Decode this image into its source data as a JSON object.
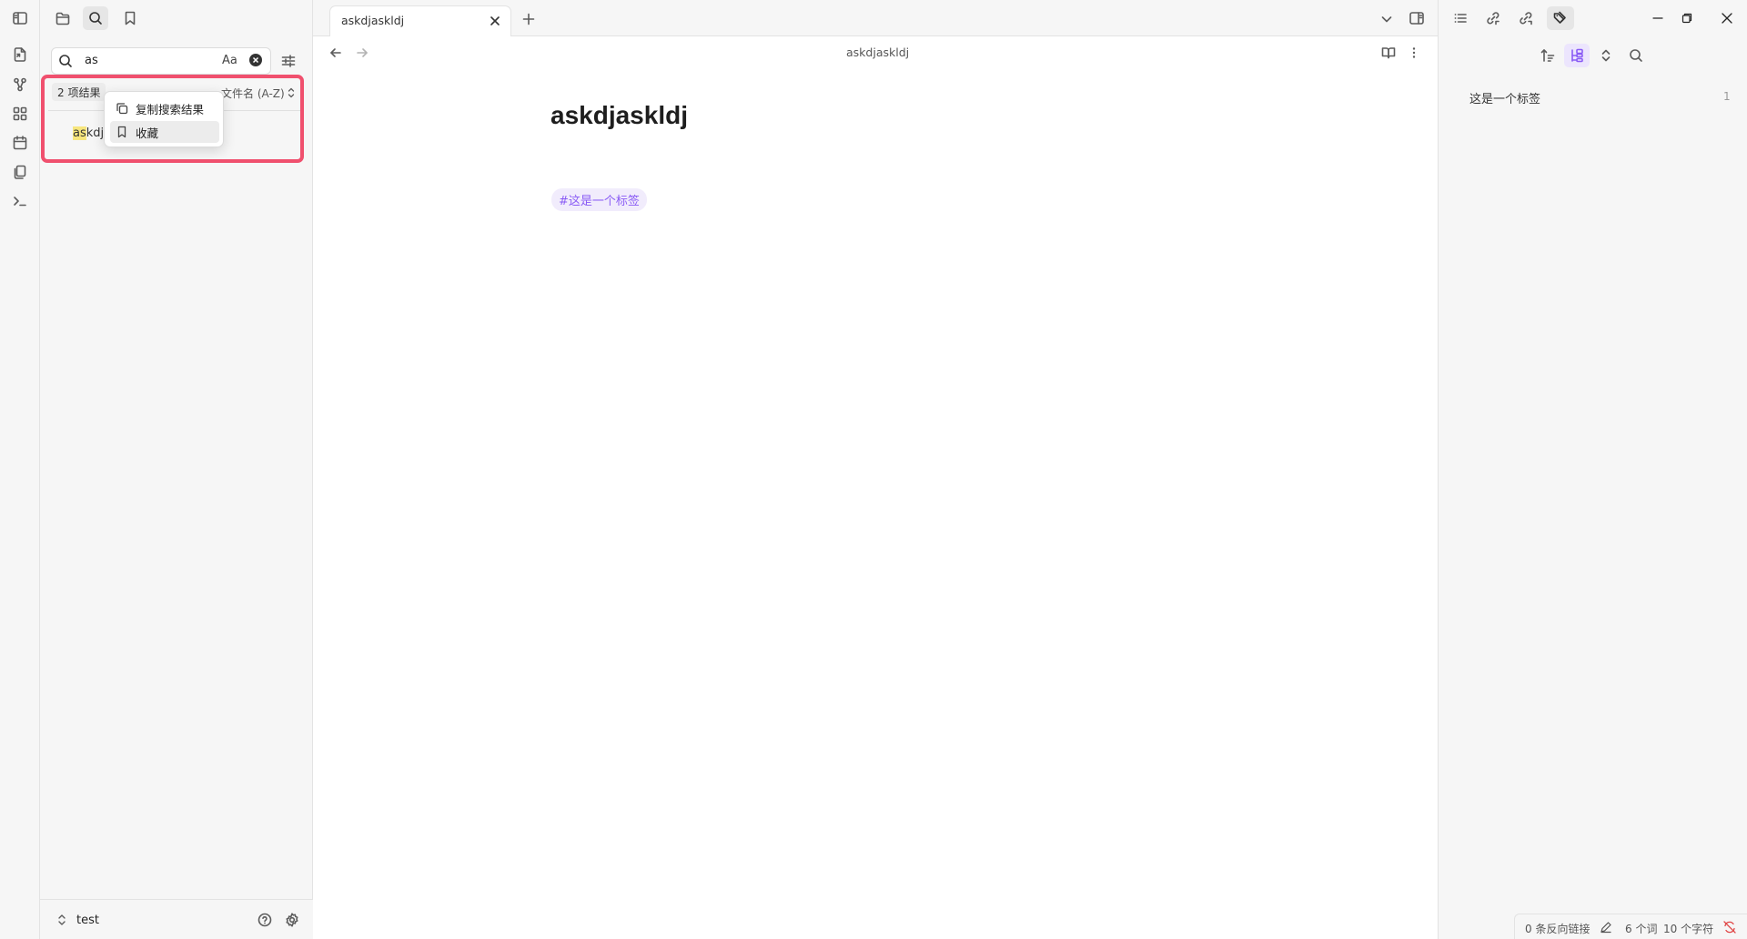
{
  "colors": {
    "accent": "#8a5cf5",
    "highlight_frame": "#f0506e",
    "match_highlight": "#f7e67d",
    "tag_bg": "#f1ecfc"
  },
  "ribbon": {
    "icons": [
      "open-quick-switcher-icon",
      "graph-view-icon",
      "canvas-icon",
      "daily-note-icon",
      "templates-icon",
      "command-palette-icon"
    ]
  },
  "left_sidebar": {
    "tabs": [
      "files-icon",
      "search-icon",
      "bookmarks-icon"
    ],
    "search": {
      "value": "as",
      "case_toggle": "Aa"
    },
    "results": {
      "count_label": "2 项结果",
      "sort_label": "文件名 (A-Z)",
      "result_title_match": "as",
      "result_title_rest": "kdja"
    },
    "context_menu": {
      "copy_label": "复制搜索结果",
      "bookmark_label": "收藏"
    },
    "vault_name": "test"
  },
  "tabbar": {
    "tab_title": "askdjaskldj"
  },
  "editor": {
    "header_title": "askdjaskldj",
    "note_title": "askdjaskldj",
    "tag": "#这是一个标签"
  },
  "right_sidebar": {
    "tag_name": "这是一个标签",
    "tag_count": "1"
  },
  "statusbar": {
    "backlinks": "0 条反向链接",
    "words": "6 个词",
    "chars": "10 个字符"
  }
}
